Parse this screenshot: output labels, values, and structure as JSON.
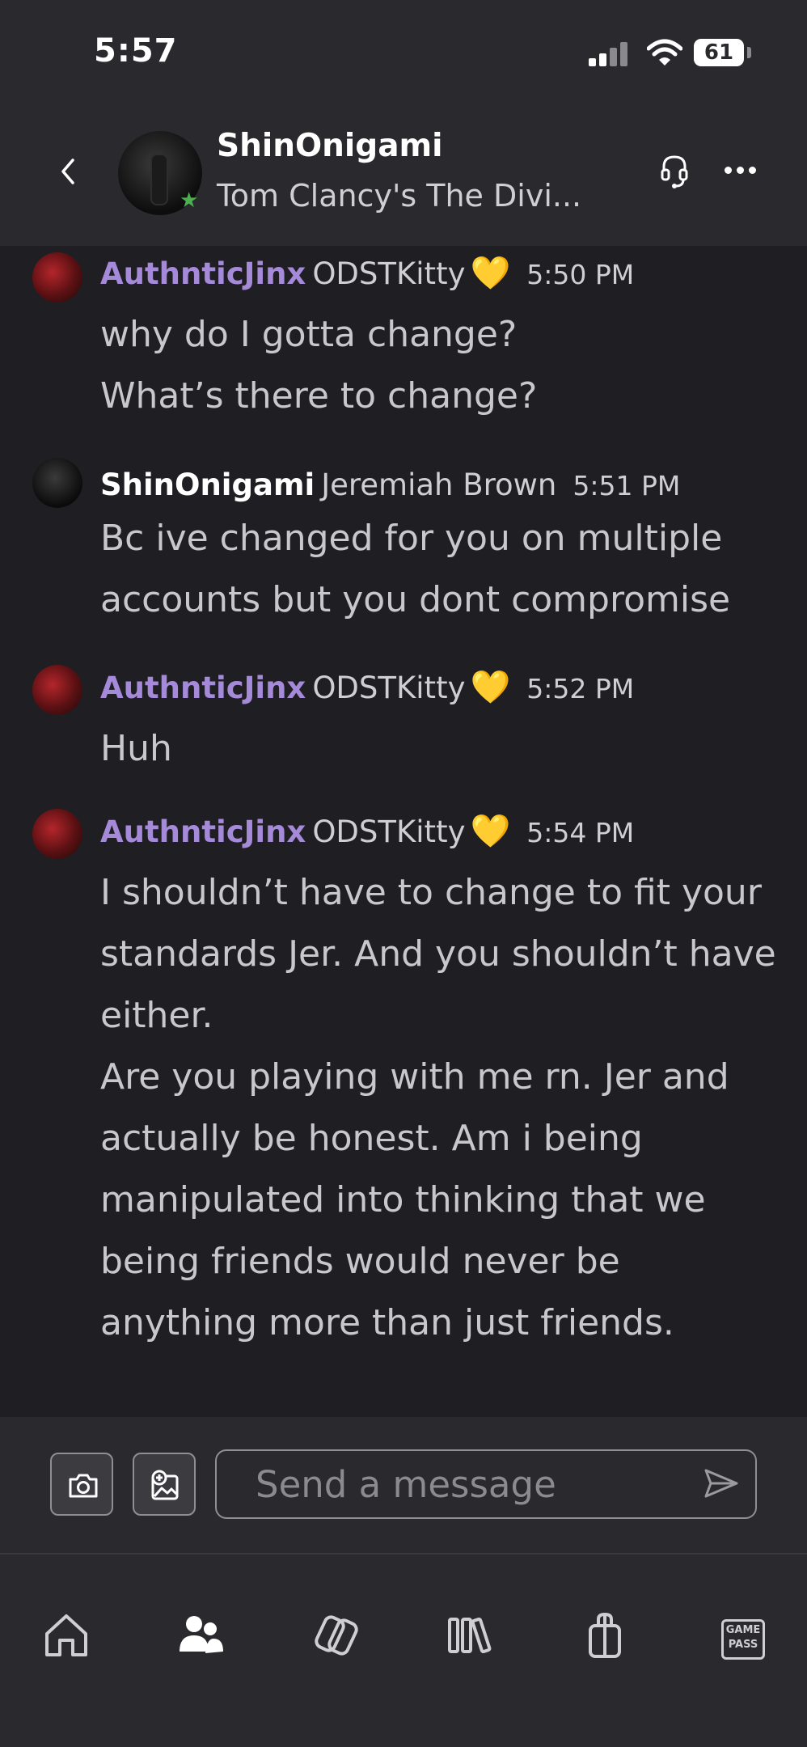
{
  "status_bar": {
    "time": "5:57",
    "battery": "61"
  },
  "header": {
    "name": "ShinOnigami",
    "game": "Tom Clancy's The Divi..."
  },
  "messages": [
    {
      "sender": "AuthnticJinx",
      "real_name": "ODSTKitty",
      "badge": "💛",
      "time": "5:50 PM",
      "lines": [
        "why do I gotta change?",
        "What’s there to change?"
      ]
    },
    {
      "sender": "ShinOnigami",
      "real_name": "Jeremiah Brown",
      "badge": "",
      "time": "5:51 PM",
      "lines": [
        "Bc ive changed for you on multiple accounts but you dont compromise"
      ]
    },
    {
      "sender": "AuthnticJinx",
      "real_name": "ODSTKitty",
      "badge": "💛",
      "time": "5:52 PM",
      "lines": [
        "Huh"
      ]
    },
    {
      "sender": "AuthnticJinx",
      "real_name": "ODSTKitty",
      "badge": "💛",
      "time": "5:54 PM",
      "lines": [
        "I shouldn’t have to change to fit your standards Jer. And you shouldn’t have either.",
        "Are you playing with me rn. Jer and actually be honest. Am i being manipulated into thinking that we being friends would never be anything more than just friends."
      ]
    }
  ],
  "composer": {
    "placeholder": "Send a message"
  },
  "nav": {
    "gamepass_label_1": "GAME",
    "gamepass_label_2": "PASS"
  },
  "colors": {
    "background": "#1f1f23",
    "header": "#2a2a2e",
    "sender_purple": "#a48ad8",
    "presence_green": "#4caf50"
  }
}
